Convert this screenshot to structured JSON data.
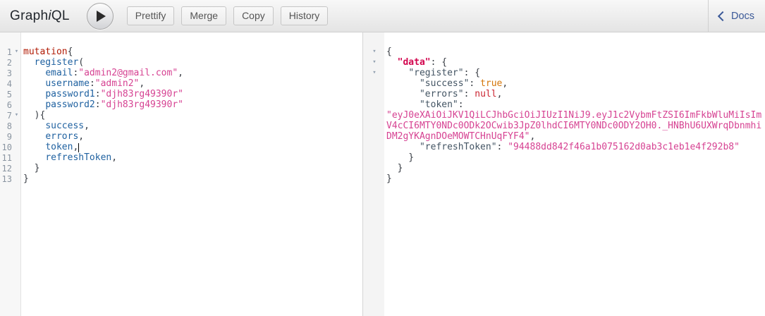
{
  "topbar": {
    "title_pre": "Graph",
    "title_italic": "i",
    "title_post": "QL",
    "buttons": [
      "Prettify",
      "Merge",
      "Copy",
      "History"
    ],
    "docs_label": "Docs"
  },
  "colors": {
    "keyword": "#B11A04",
    "field": "#1F61A0",
    "string": "#D64292",
    "boolean": "#D47509",
    "null": "#CB2431",
    "result_data_key": "#D2054E",
    "docs_link": "#3B5998"
  },
  "fold_glyph": "▾",
  "query_editor": {
    "lines": [
      {
        "n": 1,
        "fold": true,
        "tokens": [
          [
            "kw",
            "mutation"
          ],
          [
            "punc",
            "{"
          ]
        ]
      },
      {
        "n": 2,
        "fold": false,
        "tokens": [
          [
            "punc",
            "  "
          ],
          [
            "prop",
            "register"
          ],
          [
            "punc",
            "("
          ]
        ]
      },
      {
        "n": 3,
        "fold": false,
        "tokens": [
          [
            "punc",
            "    "
          ],
          [
            "prop",
            "email"
          ],
          [
            "punc",
            ":"
          ],
          [
            "str",
            "\"admin2@gmail.com\""
          ],
          [
            "punc",
            ","
          ]
        ]
      },
      {
        "n": 4,
        "fold": false,
        "tokens": [
          [
            "punc",
            "    "
          ],
          [
            "prop",
            "username"
          ],
          [
            "punc",
            ":"
          ],
          [
            "str",
            "\"admin2\""
          ],
          [
            "punc",
            ","
          ]
        ]
      },
      {
        "n": 5,
        "fold": false,
        "tokens": [
          [
            "punc",
            "    "
          ],
          [
            "prop",
            "password1"
          ],
          [
            "punc",
            ":"
          ],
          [
            "str",
            "\"djh83rg49390r\""
          ]
        ]
      },
      {
        "n": 6,
        "fold": false,
        "tokens": [
          [
            "punc",
            "    "
          ],
          [
            "prop",
            "password2"
          ],
          [
            "punc",
            ":"
          ],
          [
            "str",
            "\"djh83rg49390r\""
          ]
        ]
      },
      {
        "n": 7,
        "fold": true,
        "tokens": [
          [
            "punc",
            "  ){"
          ]
        ]
      },
      {
        "n": 8,
        "fold": false,
        "tokens": [
          [
            "punc",
            "    "
          ],
          [
            "prop",
            "success"
          ],
          [
            "punc",
            ","
          ]
        ]
      },
      {
        "n": 9,
        "fold": false,
        "tokens": [
          [
            "punc",
            "    "
          ],
          [
            "prop",
            "errors"
          ],
          [
            "punc",
            ","
          ]
        ]
      },
      {
        "n": 10,
        "fold": false,
        "tokens": [
          [
            "punc",
            "    "
          ],
          [
            "prop",
            "token"
          ],
          [
            "punc",
            ","
          ],
          [
            "cursor",
            ""
          ]
        ]
      },
      {
        "n": 11,
        "fold": false,
        "tokens": [
          [
            "punc",
            "    "
          ],
          [
            "prop",
            "refreshToken"
          ],
          [
            "punc",
            ","
          ]
        ]
      },
      {
        "n": 12,
        "fold": false,
        "tokens": [
          [
            "punc",
            "  }"
          ]
        ]
      },
      {
        "n": 13,
        "fold": false,
        "tokens": [
          [
            "punc",
            "}"
          ]
        ]
      }
    ]
  },
  "result_viewer": {
    "lines": [
      {
        "fold": true,
        "tokens": [
          [
            "punc",
            "{"
          ]
        ]
      },
      {
        "fold": true,
        "tokens": [
          [
            "punc",
            "  "
          ],
          [
            "dkey",
            "\"data\""
          ],
          [
            "punc",
            ": {"
          ]
        ]
      },
      {
        "fold": true,
        "tokens": [
          [
            "punc",
            "    "
          ],
          [
            "rkey",
            "\"register\""
          ],
          [
            "punc",
            ": {"
          ]
        ]
      },
      {
        "fold": false,
        "tokens": [
          [
            "punc",
            "      "
          ],
          [
            "rkey",
            "\"success\""
          ],
          [
            "punc",
            ": "
          ],
          [
            "bool",
            "true"
          ],
          [
            "punc",
            ","
          ]
        ]
      },
      {
        "fold": false,
        "tokens": [
          [
            "punc",
            "      "
          ],
          [
            "rkey",
            "\"errors\""
          ],
          [
            "punc",
            ": "
          ],
          [
            "nul",
            "null"
          ],
          [
            "punc",
            ","
          ]
        ]
      },
      {
        "fold": false,
        "tokens": [
          [
            "punc",
            "      "
          ],
          [
            "rkey",
            "\"token\""
          ],
          [
            "punc",
            ":"
          ]
        ]
      },
      {
        "fold": false,
        "tokens": [
          [
            "str",
            "\"eyJ0eXAiOiJKV1QiLCJhbGciOiJIUzI1NiJ9.eyJ1c2VybmFtZSI6ImFkbWluMiIsIm"
          ]
        ]
      },
      {
        "fold": false,
        "tokens": [
          [
            "str",
            "V4cCI6MTY0NDc0ODk2OCwib3JpZ0lhdCI6MTY0NDc0ODY2OH0._HNBhU6UXWrqDbnmhi"
          ]
        ]
      },
      {
        "fold": false,
        "tokens": [
          [
            "str",
            "DM2gYKAgnDOeMOWTCHnUqFYF4\""
          ],
          [
            "punc",
            ","
          ]
        ]
      },
      {
        "fold": false,
        "tokens": [
          [
            "punc",
            "      "
          ],
          [
            "rkey",
            "\"refreshToken\""
          ],
          [
            "punc",
            ": "
          ],
          [
            "str",
            "\"94488dd842f46a1b075162d0ab3c1eb1e4f292b8\""
          ]
        ]
      },
      {
        "fold": false,
        "tokens": [
          [
            "punc",
            "    }"
          ]
        ]
      },
      {
        "fold": false,
        "tokens": [
          [
            "punc",
            "  }"
          ]
        ]
      },
      {
        "fold": false,
        "tokens": [
          [
            "punc",
            "}"
          ]
        ]
      }
    ]
  }
}
